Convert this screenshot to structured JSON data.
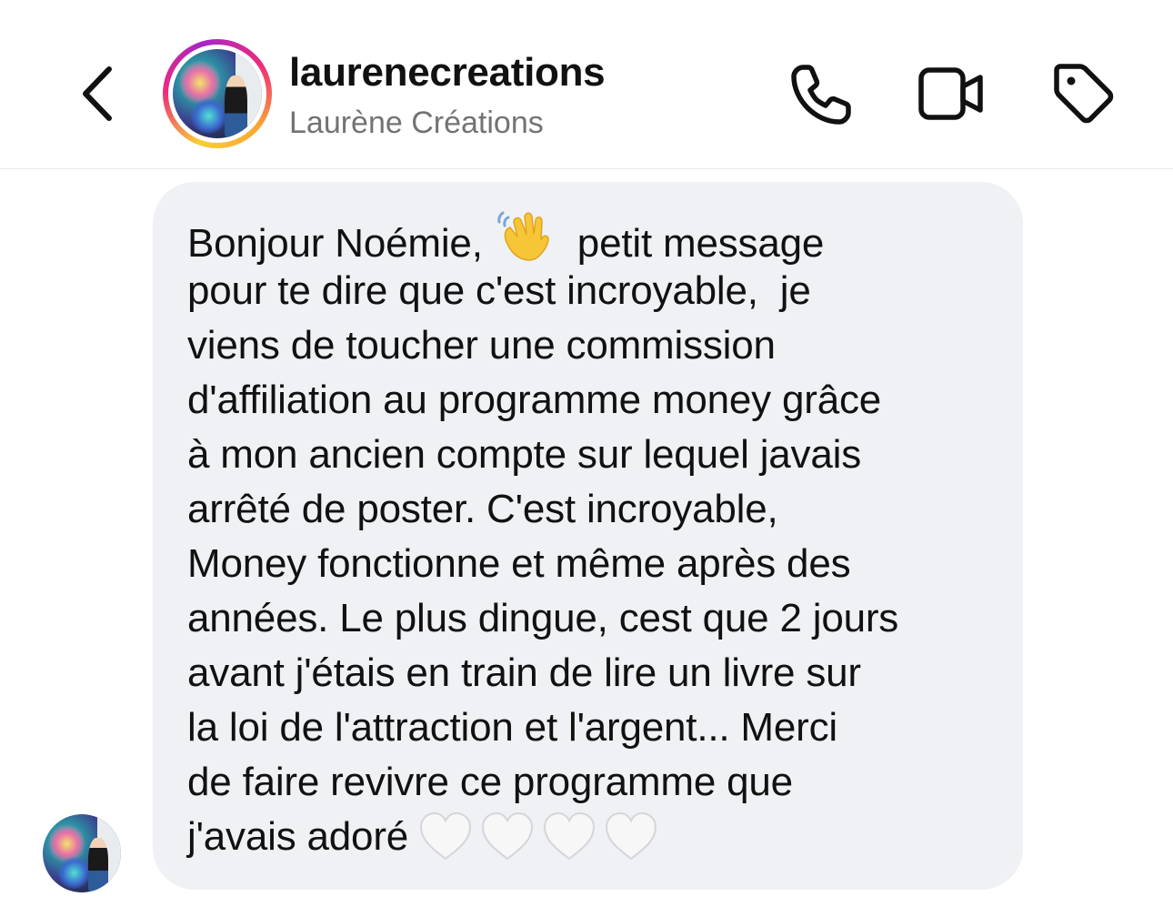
{
  "header": {
    "username": "laurenecreations",
    "display_name": "Laurène Créations",
    "icons": {
      "back": "chevron-left-icon",
      "call": "phone-icon",
      "video": "video-camera-icon",
      "tag": "tag-icon"
    }
  },
  "message": {
    "lines": [
      {
        "before": "Bonjour Noémie, ",
        "emoji": "waving-hand",
        "after": "  petit message"
      },
      {
        "text": "pour te dire que c'est incroyable,  je"
      },
      {
        "text": "viens de toucher une commission"
      },
      {
        "text": "d'affiliation au programme money grâce"
      },
      {
        "text": "à mon ancien compte sur lequel javais"
      },
      {
        "text": "arrêté de poster. C'est incroyable,"
      },
      {
        "text": "Money fonctionne et même après des"
      },
      {
        "text": "années. Le plus dingue, cest que 2 jours"
      },
      {
        "text": "avant j'étais en train de lire un livre sur"
      },
      {
        "text": "la loi de l'attraction et l'argent... Merci"
      },
      {
        "text": "de faire revivre ce programme que"
      },
      {
        "before": "j'avais adoré",
        "emoji": "white-heart",
        "emoji_count": 4
      }
    ]
  },
  "colors": {
    "bubble_bg": "#eff1f4",
    "text": "#111111",
    "secondary_text": "#737373",
    "ring_gradient": [
      "#f9ce34",
      "#ee2a7b",
      "#a626c7"
    ]
  }
}
